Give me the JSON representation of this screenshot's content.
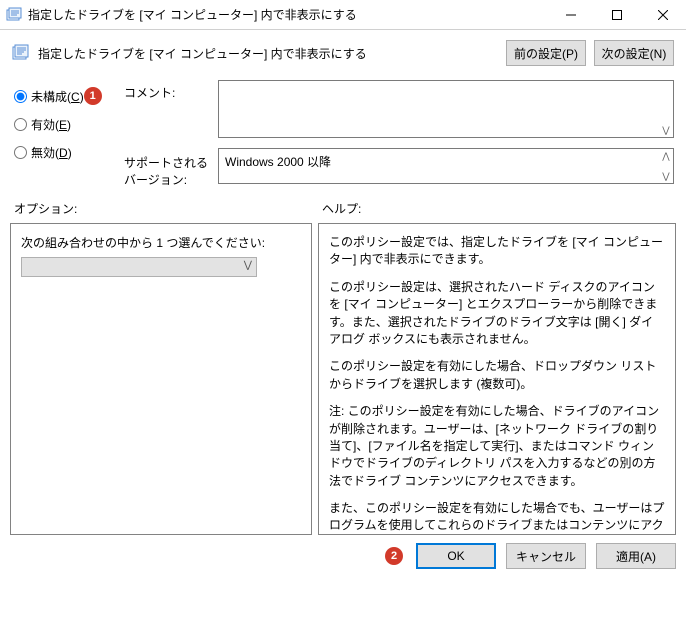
{
  "window": {
    "title": "指定したドライブを [マイ コンピューター] 内で非表示にする",
    "header_title": "指定したドライブを [マイ コンピューター] 内で非表示にする"
  },
  "nav": {
    "prev_label": "前の設定(P)",
    "next_label": "次の設定(N)"
  },
  "radios": {
    "not_configured": "未構成",
    "not_configured_key": "C",
    "enabled": "有効",
    "enabled_key": "E",
    "disabled": "無効",
    "disabled_key": "D"
  },
  "badges": {
    "one": "1",
    "two": "2"
  },
  "labels": {
    "comment": "コメント:",
    "supported": "サポートされるバージョン:",
    "options": "オプション:",
    "help": "ヘルプ:"
  },
  "supported_text": "Windows 2000 以降",
  "options": {
    "prompt": "次の組み合わせの中から 1 つ選んでください:"
  },
  "help": {
    "p1": "このポリシー設定では、指定したドライブを [マイ コンピューター] 内で非表示にできます。",
    "p2": "このポリシー設定は、選択されたハード ディスクのアイコンを [マイ コンピューター] とエクスプローラーから削除できます。また、選択されたドライブのドライブ文字は [開く] ダイアログ ボックスにも表示されません。",
    "p3": "このポリシー設定を有効にした場合、ドロップダウン リストからドライブを選択します (複数可)。",
    "p4": "注: このポリシー設定を有効にした場合、ドライブのアイコンが削除されます。ユーザーは、[ネットワーク ドライブの割り当て]、[ファイル名を指定して実行]、またはコマンド ウィンドウでドライブのディレクトリ パスを入力するなどの別の方法でドライブ コンテンツにアクセスできます。",
    "p5": "また、このポリシー設定を有効にした場合でも、ユーザーはプログラムを使用してこれらのドライブまたはコンテンツにアクセスできます。また、ユーザーがディスクの管理スナップインを使用して、ドライブ文字を表示および変更できなくなることもありません。"
  },
  "footer": {
    "ok": "OK",
    "cancel": "キャンセル",
    "apply": "適用(A)"
  }
}
